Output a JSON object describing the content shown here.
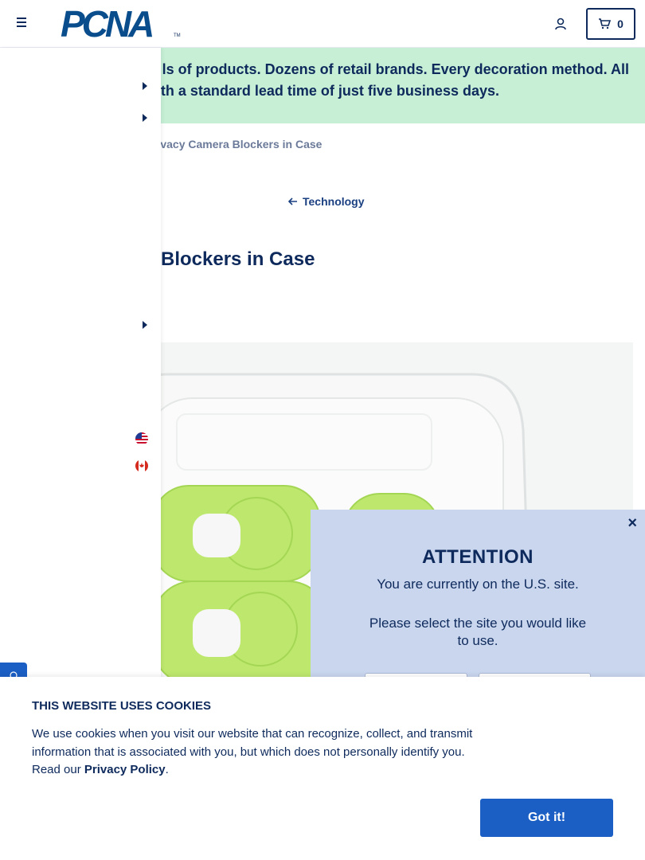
{
  "header": {
    "logo_text": "PCNA",
    "logo_tm": "TM",
    "cart_count": "0"
  },
  "banner": {
    "line1": "ls of products. Dozens of retail brands. Every decoration method. All",
    "line2": "th a standard lead time of just five business days."
  },
  "breadcrumb": {
    "current": "rivacy Camera Blockers in Case"
  },
  "back_link": {
    "label": "Technology"
  },
  "product": {
    "title": "Blockers in Case"
  },
  "side_menu": {
    "icons": [
      "caret-right-icon",
      "caret-right-icon",
      "caret-right-icon",
      "us-flag-icon",
      "canada-flag-icon"
    ]
  },
  "attention": {
    "close": "×",
    "title": "ATTENTION",
    "message": "You are currently on the U.S. site.",
    "prompt": "Please select the site you would like to use."
  },
  "cookie": {
    "title": "THIS WEBSITE USES COOKIES",
    "body": "We use cookies when you visit our website that can recognize, collect, and transmit information that is associated with you, but which does not personally identify you. Read our ",
    "link": "Privacy Policy",
    "period": ".",
    "button": "Got it!"
  },
  "colors": {
    "navy": "#0e2a5c",
    "banner_bg": "#c6efd5",
    "modal_bg": "#c9d6ee",
    "button_blue": "#1b5fc4",
    "product_green": "#b7e86a"
  }
}
